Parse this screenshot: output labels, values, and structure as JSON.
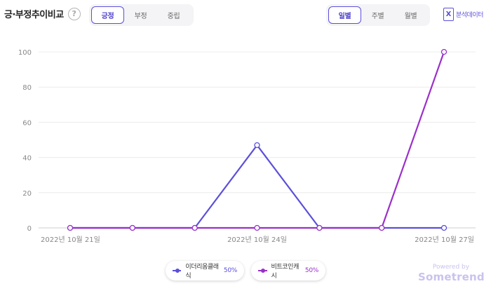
{
  "header": {
    "title": "긍·부정추이비교",
    "help_symbol": "?",
    "sentiment_tabs": [
      {
        "label": "긍정",
        "active": true
      },
      {
        "label": "부정",
        "active": false
      },
      {
        "label": "중립",
        "active": false
      }
    ],
    "period_tabs": [
      {
        "label": "일별",
        "active": true
      },
      {
        "label": "주별",
        "active": false
      },
      {
        "label": "월별",
        "active": false
      }
    ],
    "export_icon_glyph": "X",
    "export_label": "분석데이터"
  },
  "chart_data": {
    "type": "line",
    "x": [
      "2022-10-21",
      "2022-10-22",
      "2022-10-23",
      "2022-10-24",
      "2022-10-25",
      "2022-10-26",
      "2022-10-27"
    ],
    "x_tick_labels": [
      "2022년 10월 21일",
      "2022년 10월 24일",
      "2022년 10월 27일"
    ],
    "x_tick_indices": [
      0,
      3,
      6
    ],
    "y_ticks": [
      0,
      20,
      40,
      60,
      80,
      100
    ],
    "ylim": [
      0,
      100
    ],
    "grid": "horizontal",
    "series": [
      {
        "name": "이더리움클래식",
        "share": "50%",
        "color": "#5b4fdb",
        "values": [
          0,
          0,
          0,
          47,
          0,
          0,
          0
        ]
      },
      {
        "name": "비트코인캐시",
        "share": "50%",
        "color": "#9b30c9",
        "values": [
          0,
          0,
          0,
          0,
          0,
          0,
          100
        ]
      }
    ]
  },
  "branding": {
    "powered_by": "Powered by",
    "brand": "Sometrend"
  }
}
